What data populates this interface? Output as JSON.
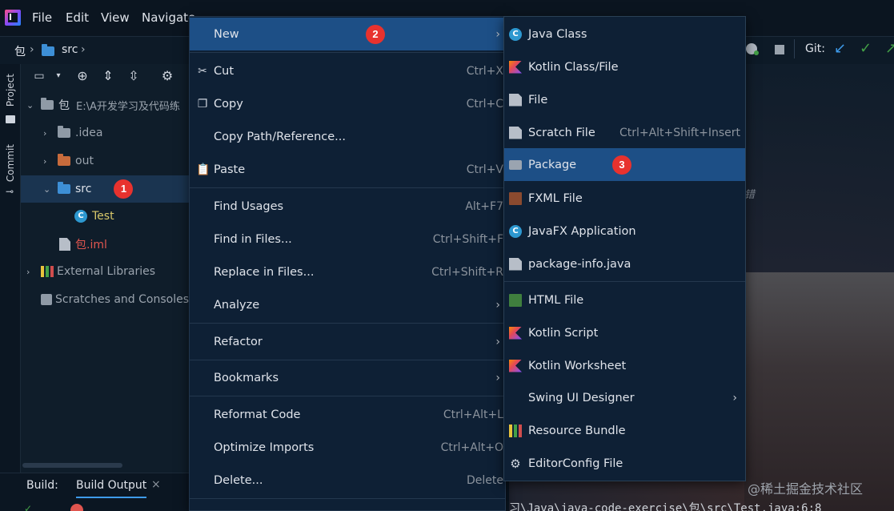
{
  "menubar": {
    "items": [
      "File",
      "Edit",
      "View",
      "Navigate"
    ]
  },
  "breadcrumb": {
    "root": "包",
    "folder": "src"
  },
  "side_tabs": {
    "project": "Project",
    "commit": "Commit"
  },
  "project_tree": {
    "root_label": "包",
    "root_path": "E:\\A开发学习及代码练",
    "idea": ".idea",
    "out": "out",
    "src": "src",
    "test": "Test",
    "iml": "包.iml",
    "external_libraries": "External Libraries",
    "scratches": "Scratches and Consoles"
  },
  "markers": {
    "one": "1",
    "two": "2",
    "three": "3"
  },
  "context_menu": {
    "new": "New",
    "cut": "Cut",
    "cut_sc": "Ctrl+X",
    "copy": "Copy",
    "copy_sc": "Ctrl+C",
    "copy_path": "Copy Path/Reference...",
    "paste": "Paste",
    "paste_sc": "Ctrl+V",
    "find_usages": "Find Usages",
    "find_usages_sc": "Alt+F7",
    "find_in_files": "Find in Files...",
    "find_in_files_sc": "Ctrl+Shift+F",
    "replace_in_files": "Replace in Files...",
    "replace_in_files_sc": "Ctrl+Shift+R",
    "analyze": "Analyze",
    "refactor": "Refactor",
    "bookmarks": "Bookmarks",
    "reformat": "Reformat Code",
    "reformat_sc": "Ctrl+Alt+L",
    "optimize": "Optimize Imports",
    "optimize_sc": "Ctrl+Alt+O",
    "delete": "Delete...",
    "delete_sc": "Delete"
  },
  "submenu": {
    "java_class": "Java Class",
    "kotlin_class": "Kotlin Class/File",
    "file": "File",
    "scratch": "Scratch File",
    "scratch_sc": "Ctrl+Alt+Shift+Insert",
    "package": "Package",
    "fxml": "FXML File",
    "javafx": "JavaFX Application",
    "package_info": "package-info.java",
    "html": "HTML File",
    "kotlin_script": "Kotlin Script",
    "kotlin_worksheet": "Kotlin Worksheet",
    "swing": "Swing UI Designer",
    "resource_bundle": "Resource Bundle",
    "editorconfig": "EditorConfig File"
  },
  "right_toolbar": {
    "git": "Git:"
  },
  "editor": {
    "tail_text": "错"
  },
  "build": {
    "label": "Build:",
    "tab": "Build Output"
  },
  "bottom_path": "习\\Java\\java-code-exercise\\包\\src\\Test.java:6:8",
  "watermark": "@稀土掘金技术社区",
  "colors": {
    "accent": "#1d4f86",
    "marker": "#e8322e",
    "menu_bg": "#0e2035"
  }
}
